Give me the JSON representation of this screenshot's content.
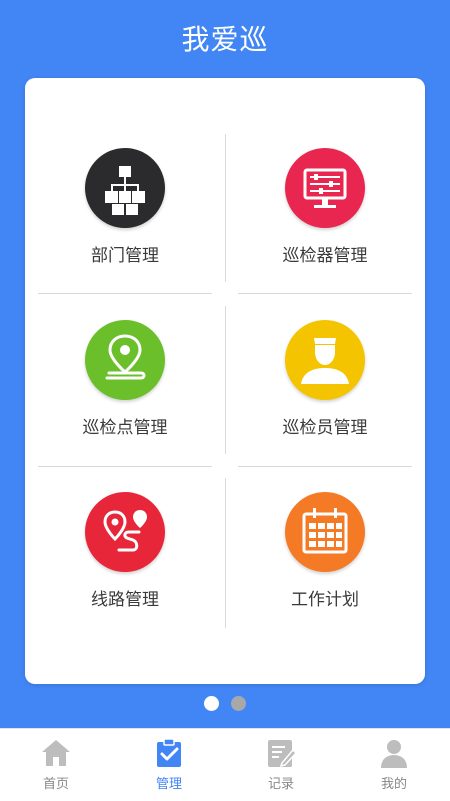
{
  "app": {
    "title": "我爱巡"
  },
  "grid": {
    "items": [
      {
        "label": "部门管理",
        "icon": "org-chart-icon",
        "color": "#2b2b2e"
      },
      {
        "label": "巡检器管理",
        "icon": "monitor-sliders-icon",
        "color": "#e8264f"
      },
      {
        "label": "巡检点管理",
        "icon": "location-pin-icon",
        "color": "#6bbf2b"
      },
      {
        "label": "巡检员管理",
        "icon": "inspector-person-icon",
        "color": "#f5c400"
      },
      {
        "label": "线路管理",
        "icon": "route-icon",
        "color": "#e8263a"
      },
      {
        "label": "工作计划",
        "icon": "calendar-icon",
        "color": "#f57a26"
      }
    ]
  },
  "pager": {
    "page_count": 2,
    "active_index": 0,
    "active_color": "#ffffff",
    "inactive_color": "#a8a8a8"
  },
  "tabbar": {
    "tabs": [
      {
        "label": "首页",
        "icon": "home-icon",
        "active": false
      },
      {
        "label": "管理",
        "icon": "clipboard-check-icon",
        "active": true
      },
      {
        "label": "记录",
        "icon": "notepad-pen-icon",
        "active": false
      },
      {
        "label": "我的",
        "icon": "user-icon",
        "active": false
      }
    ],
    "active_color": "#4285f4",
    "inactive_color": "#bdbdbd"
  }
}
